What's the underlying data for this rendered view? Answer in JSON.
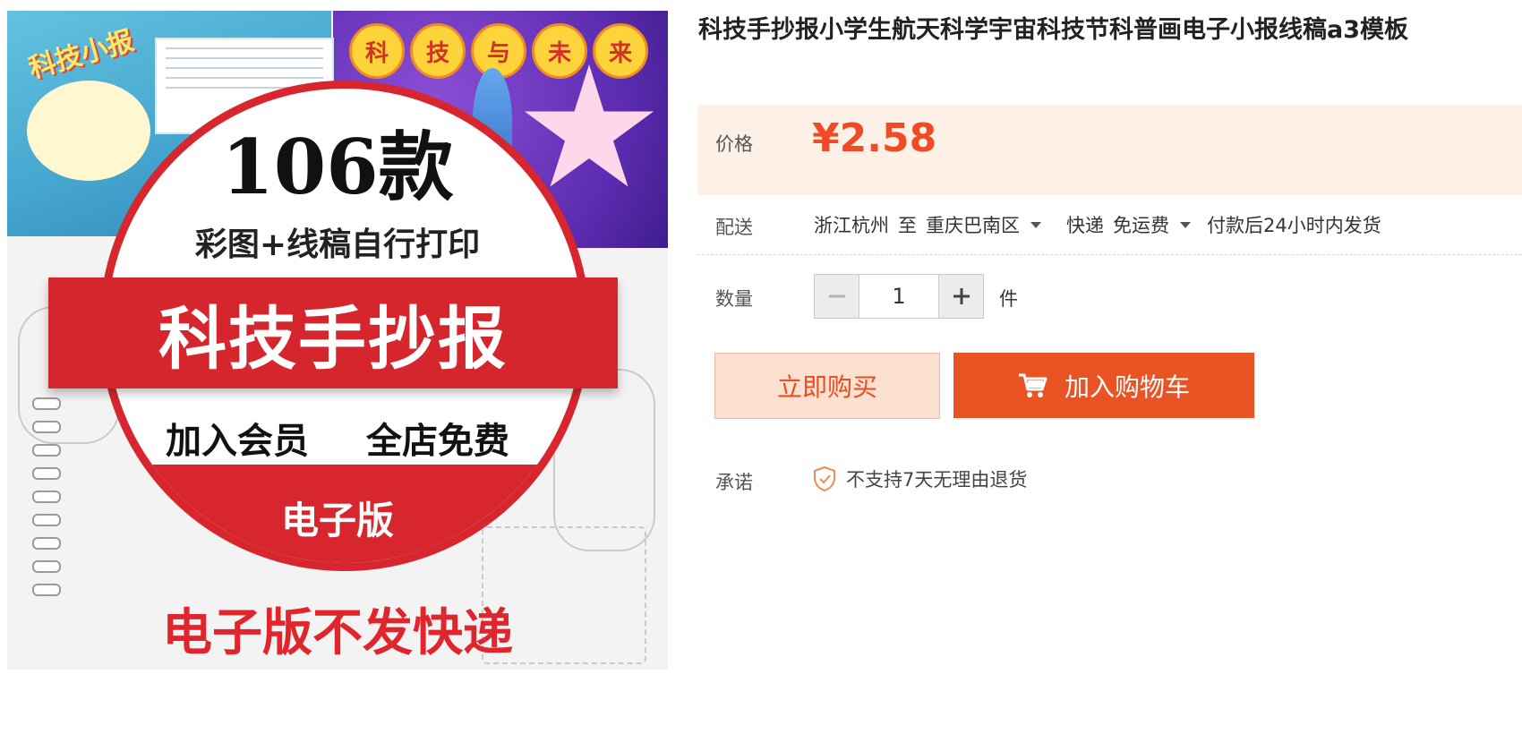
{
  "product": {
    "title": "科技手抄报小学生航天科学宇宙科技节科普画电子小报线稿a3模板",
    "image": {
      "headline_count": "106款",
      "subtitle": "彩图+线稿自行打印",
      "banner": "科技手抄报",
      "promo": "加入会员 全店免费",
      "edition": "电子版",
      "notice": "电子版不发快递",
      "kid_title": "科技小报",
      "badge_chars": [
        "科",
        "技",
        "与",
        "未",
        "来"
      ]
    }
  },
  "price": {
    "label": "价格",
    "currency": "¥",
    "value": "2.58",
    "color": "#ef4c26"
  },
  "delivery": {
    "label": "配送",
    "origin": "浙江杭州",
    "to": "至",
    "destination": "重庆巴南区",
    "method": "快递",
    "fee": "免运费",
    "ship_time": "付款后24小时内发货"
  },
  "quantity": {
    "label": "数量",
    "value": "1",
    "unit": "件",
    "minus_icon": "minus-icon",
    "plus_icon": "plus-icon"
  },
  "actions": {
    "buy_now_label": "立即购买",
    "add_cart_label": "加入购物车",
    "cart_icon": "cart-icon",
    "accent_color": "#ea5323"
  },
  "promise": {
    "label": "承诺",
    "text": "不支持7天无理由退货",
    "icon": "shield-check-icon"
  }
}
